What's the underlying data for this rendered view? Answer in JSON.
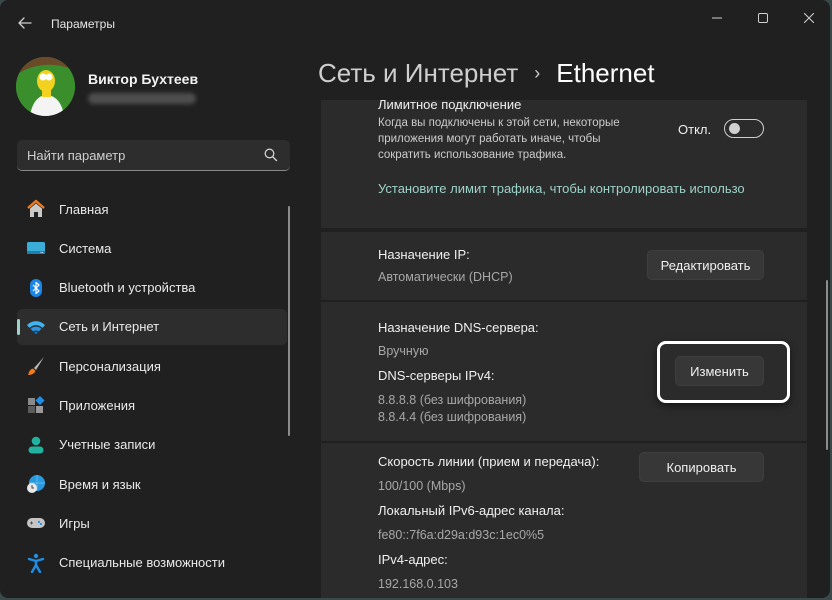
{
  "window": {
    "title": "Параметры",
    "controls": {
      "minimize": "minimize-icon",
      "maximize": "maximize-icon",
      "close": "close-icon"
    }
  },
  "profile": {
    "name": "Виктор Бухтеев",
    "email_blurred": true
  },
  "search": {
    "placeholder": "Найти параметр",
    "value": ""
  },
  "sidebar": {
    "items": [
      {
        "label": "Главная",
        "icon": "home-icon",
        "active": false
      },
      {
        "label": "Система",
        "icon": "display-icon",
        "active": false
      },
      {
        "label": "Bluetooth и устройства",
        "icon": "bluetooth-icon",
        "active": false
      },
      {
        "label": "Сеть и Интернет",
        "icon": "wifi-icon",
        "active": true
      },
      {
        "label": "Персонализация",
        "icon": "brush-icon",
        "active": false
      },
      {
        "label": "Приложения",
        "icon": "apps-icon",
        "active": false
      },
      {
        "label": "Учетные записи",
        "icon": "account-icon",
        "active": false
      },
      {
        "label": "Время и язык",
        "icon": "time-language-icon",
        "active": false
      },
      {
        "label": "Игры",
        "icon": "gamepad-icon",
        "active": false
      },
      {
        "label": "Специальные возможности",
        "icon": "accessibility-icon",
        "active": false
      }
    ]
  },
  "breadcrumb": {
    "parent": "Сеть и Интернет",
    "separator": "›",
    "current": "Ethernet"
  },
  "metered": {
    "title": "Лимитное подключение",
    "description_lines": [
      "Когда вы подключены к этой сети, некоторые",
      "приложения могут работать иначе, чтобы",
      "сократить использование трафика."
    ],
    "toggle_label": "Откл.",
    "toggle_on": false,
    "link": "Установите лимит трафика, чтобы контролировать использо"
  },
  "ip_assignment": {
    "label": "Назначение IP:",
    "value": "Автоматически (DHCP)",
    "button": "Редактировать"
  },
  "dns": {
    "label": "Назначение DNS-сервера:",
    "value": "Вручную",
    "servers_label": "DNS-серверы IPv4:",
    "servers": [
      "8.8.8.8 (без шифрования)",
      "8.8.4.4 (без шифрования)"
    ],
    "button": "Изменить"
  },
  "properties": {
    "speed_label": "Скорость линии (прием и передача):",
    "speed_value": "100/100 (Mbps)",
    "ipv6_label": "Локальный IPv6-адрес канала:",
    "ipv6_value": "fe80::7f6a:d29a:d93c:1ec0%5",
    "ipv4_label": "IPv4-адрес:",
    "ipv4_value": "192.168.0.103",
    "copy_button": "Копировать"
  },
  "colors": {
    "background": "#202020",
    "card": "#2b2b2b",
    "accent": "#9dd3c9",
    "button": "#373737"
  }
}
